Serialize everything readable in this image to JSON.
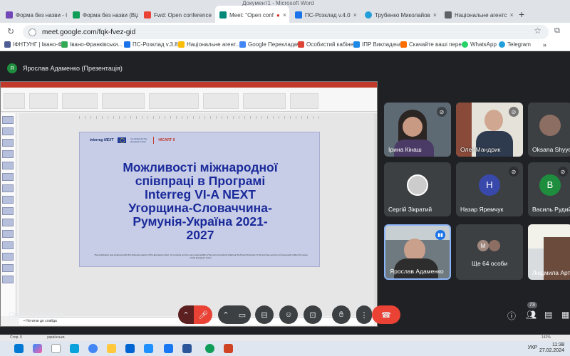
{
  "browser": {
    "window_title": "Документ1 - Microsoft Word",
    "tabs": [
      {
        "title": "Форма без назви - Go",
        "color": "#7248b9"
      },
      {
        "title": "Форма без назви (Від",
        "color": "#0f9d58"
      },
      {
        "title": "Fwd: Open conference",
        "color": "#ea4335"
      },
      {
        "title": "Meet: \"Open conf",
        "color": "#00897b",
        "recording": "●"
      },
      {
        "title": "ПС-Розклад v.4.0",
        "color": "#1a73e8"
      },
      {
        "title": "Трубенко Миколайов",
        "color": "#229ed9"
      },
      {
        "title": "Національне агентс",
        "color": "#5f6368"
      }
    ],
    "new_tab": "+",
    "url": "meet.google.com/fqk-fvez-gid",
    "bookmarks": [
      {
        "label": "ІФНТУНГ | Івано-Ф...",
        "color": "#4e5d94"
      },
      {
        "label": "Івано-Франківськи...",
        "color": "#34a853"
      },
      {
        "label": "ПС-Розклад v.3.8.2",
        "color": "#1a73e8"
      },
      {
        "label": "Національне агент...",
        "color": "#fbbc04"
      },
      {
        "label": "Google Перекладач",
        "color": "#4285f4"
      },
      {
        "label": "Особистий кабінет",
        "color": "#db4437"
      },
      {
        "label": "ІПР Викладача",
        "color": "#1e88e5"
      },
      {
        "label": "Скачайте ваші пере...",
        "color": "#ff6d00"
      },
      {
        "label": "WhatsApp",
        "color": "#25d366"
      },
      {
        "label": "Telegram",
        "color": "#229ed9"
      }
    ]
  },
  "meet": {
    "presenter_label": "Ярослав Адаменко (Презентація)",
    "presenter_initial": "Я",
    "meeting_name": "Open conference",
    "participant_count": "73",
    "slide": {
      "logo_text": "interreg NEXT",
      "eu_text": "Co-funded by the European Union",
      "project": "HICART II",
      "title": "Можливості міжнародної\nспівпраці в Програмі\nInterreg VI-A NEXT\nУгорщина-Словаччина-\nРумунія-Україна 2021-\n2027",
      "disclaimer": "This publication was produced with the financial support of the European Union. Its contents are the sole responsibility of the Ivano-Frankivsk National Technical University of Oil and Gas and do not necessarily reflect the views of the European Union.",
      "notes_label": "Нотатки до слайда"
    },
    "participants": [
      {
        "name": "Ірина Кінаш",
        "muted": true,
        "type": "video"
      },
      {
        "name": "Олег Мандрик",
        "muted": true,
        "type": "video"
      },
      {
        "name": "Oksana Shyyo",
        "muted": false,
        "type": "photo"
      },
      {
        "name": "Сергій Зікратий",
        "muted": false,
        "type": "photo"
      },
      {
        "name": "Назар Яремчук",
        "muted": true,
        "type": "avatar",
        "initial": "Н",
        "color": "#3949ab"
      },
      {
        "name": "Василь Рудий",
        "muted": true,
        "type": "avatar",
        "initial": "В",
        "color": "#1e8e3e"
      },
      {
        "name": "Ярослав Адаменко",
        "muted": false,
        "type": "video",
        "speaking": true
      },
      {
        "name": "Ще 64 особи",
        "type": "more",
        "initial": "M"
      },
      {
        "name": "Людмила Арт",
        "type": "video"
      }
    ]
  },
  "word_status": {
    "page": "Стор. 0",
    "language": "українська",
    "zoom": "142%"
  },
  "taskbar": {
    "language": "УКР",
    "time": "11:38",
    "date": "27.02.2024"
  }
}
